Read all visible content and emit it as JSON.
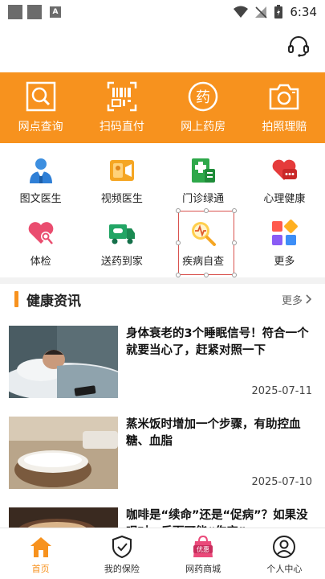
{
  "status_bar": {
    "time": "6:34",
    "a_badge": "A"
  },
  "banner": {
    "color": "#f7921e",
    "items": [
      {
        "label": "网点查询",
        "icon": "search-icon"
      },
      {
        "label": "扫码直付",
        "icon": "barcode-icon"
      },
      {
        "label": "网上药房",
        "icon": "pharmacy-icon"
      },
      {
        "label": "拍照理赔",
        "icon": "camera-icon"
      }
    ]
  },
  "services": {
    "row1": [
      {
        "label": "图文医生",
        "icon": "doctor-icon"
      },
      {
        "label": "视频医生",
        "icon": "video-doctor-icon"
      },
      {
        "label": "门诊绿通",
        "icon": "clinic-icon"
      },
      {
        "label": "心理健康",
        "icon": "heart-chat-icon"
      }
    ],
    "row2": [
      {
        "label": "体检",
        "icon": "checkup-icon"
      },
      {
        "label": "送药到家",
        "icon": "delivery-truck-icon"
      },
      {
        "label": "疾病自查",
        "icon": "self-check-icon"
      },
      {
        "label": "更多",
        "icon": "more-apps-icon"
      }
    ]
  },
  "health_news": {
    "title": "健康资讯",
    "more": "更多",
    "articles": [
      {
        "title": "身体衰老的3个睡眠信号！符合一个就要当心了，赶紧对照一下",
        "date": "2025-07-11"
      },
      {
        "title": "蒸米饭时增加一个步骤，有助控血糖、血脂",
        "date": "2025-07-10"
      },
      {
        "title": "咖啡是“续命”还是“促病”？如果没喝对，反而可能“伤害”",
        "date": ""
      }
    ]
  },
  "bottom_nav": [
    {
      "label": "首页",
      "icon": "home-icon"
    },
    {
      "label": "我的保险",
      "icon": "shield-check-icon"
    },
    {
      "label": "网药商城",
      "icon": "mall-icon",
      "badge": "优惠"
    },
    {
      "label": "个人中心",
      "icon": "user-icon"
    }
  ]
}
